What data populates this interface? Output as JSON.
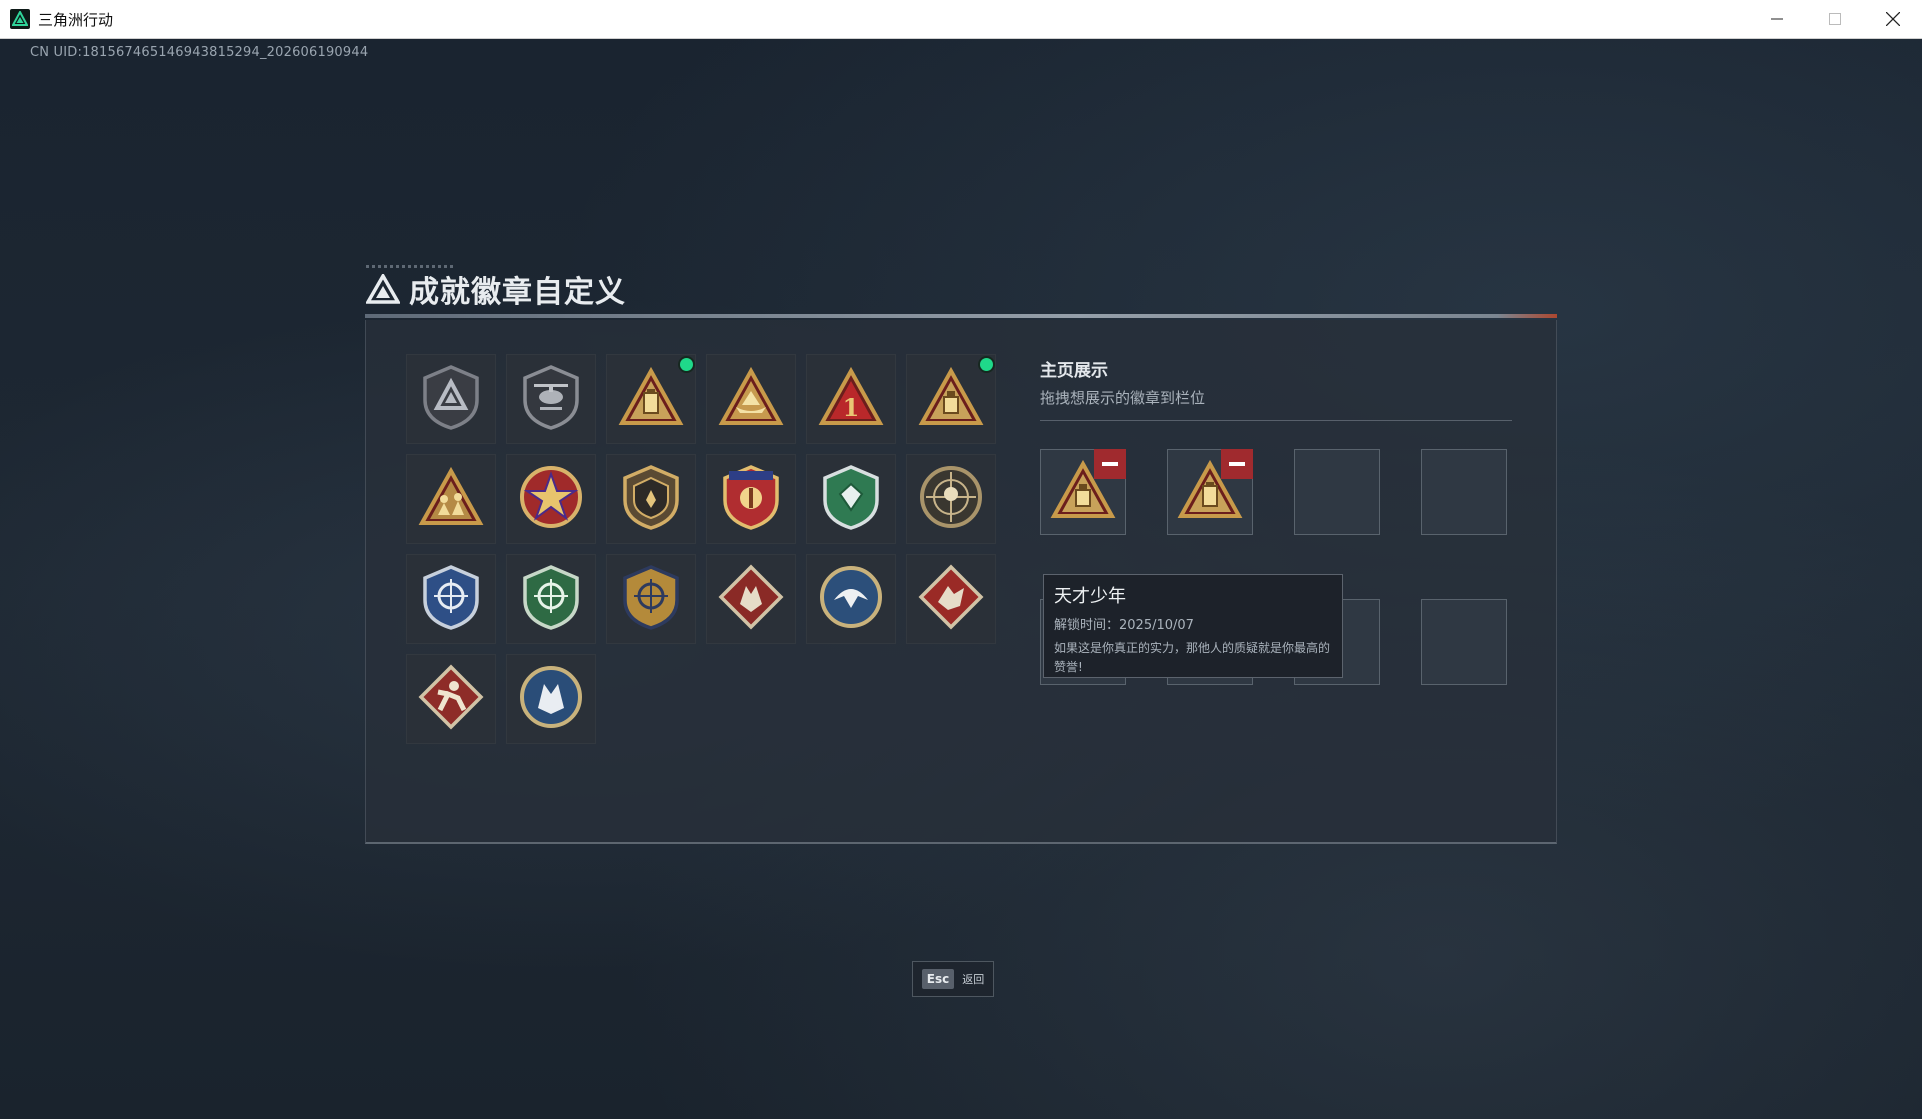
{
  "window": {
    "title": "三角洲行动"
  },
  "uid_text": "CN UID:1815674651469438152​94_202606190944",
  "page": {
    "title": "成就徽章自定义"
  },
  "badges": [
    {
      "icon": "grey-triangle-shield-badge",
      "new": false
    },
    {
      "icon": "helicopter-shield-badge",
      "new": false
    },
    {
      "icon": "gold-lantern-triangle-badge",
      "new": true
    },
    {
      "icon": "gold-boat-triangle-badge",
      "new": false
    },
    {
      "icon": "gold-number-one-triangle-badge",
      "new": false
    },
    {
      "icon": "gold-usb-triangle-badge",
      "new": true
    },
    {
      "icon": "gold-soldiers-triangle-badge",
      "new": false
    },
    {
      "icon": "red-star-medal-badge",
      "new": false
    },
    {
      "icon": "gold-hand-shield-badge",
      "new": false
    },
    {
      "icon": "blue-star-crest-badge",
      "new": false
    },
    {
      "icon": "green-gem-shield-badge",
      "new": false
    },
    {
      "icon": "skull-crosshair-badge",
      "new": false
    },
    {
      "icon": "blue-crosshair-shield-badge",
      "new": false
    },
    {
      "icon": "green-crosshair-shield-badge",
      "new": false
    },
    {
      "icon": "gold-crosshair-shield-badge",
      "new": false
    },
    {
      "icon": "red-wolf-diamond-badge",
      "new": false
    },
    {
      "icon": "blue-eagle-circle-badge",
      "new": false
    },
    {
      "icon": "red-dragon-diamond-badge",
      "new": false
    },
    {
      "icon": "red-runner-diamond-badge",
      "new": false
    },
    {
      "icon": "blue-wolf-circle-badge",
      "new": false
    }
  ],
  "showcase": {
    "title": "主页展示",
    "subtitle": "拖拽想展示的徽章到栏位",
    "slots": [
      {
        "icon": "gold-usb-triangle-badge",
        "filled": true
      },
      {
        "icon": "gold-lantern-triangle-badge",
        "filled": true
      },
      {
        "icon": "",
        "filled": false
      },
      {
        "icon": "",
        "filled": false
      },
      {
        "icon": "",
        "filled": false
      },
      {
        "icon": "",
        "filled": false
      },
      {
        "icon": "",
        "filled": false
      },
      {
        "icon": "",
        "filled": false
      }
    ]
  },
  "tooltip": {
    "title": "天才少年",
    "unlock_time": "解锁时间：2025/10/07",
    "description": "如果这是你真正的实力，那他人的质疑就是你最高的赞誉!"
  },
  "footer": {
    "esc_key": "Esc",
    "back_label": "返回"
  },
  "colors": {
    "new_dot": "#1fd98a",
    "remove_button": "#a02a2e",
    "accent_line_end": "#c44a2c"
  }
}
